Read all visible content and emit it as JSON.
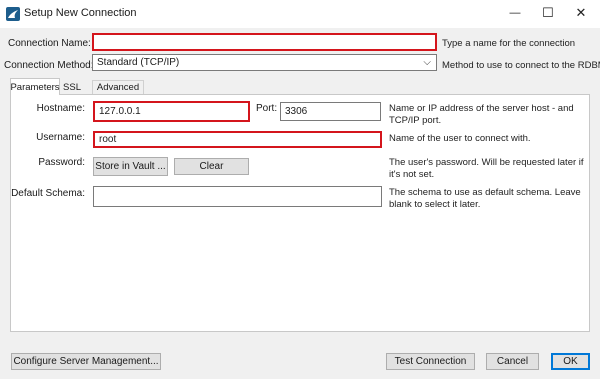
{
  "window": {
    "title": "Setup New Connection",
    "icon": "mysql-workbench-icon",
    "controls": {
      "minimize": "—",
      "maximize": "☐",
      "close": "✕"
    }
  },
  "connection_name": {
    "label": "Connection Name:",
    "value": "",
    "hint": "Type a name for the connection"
  },
  "connection_method": {
    "label": "Connection Method:",
    "value": "Standard (TCP/IP)",
    "hint": "Method to use to connect to the RDBMS"
  },
  "tabs": [
    {
      "label": "Parameters",
      "active": true
    },
    {
      "label": "SSL",
      "active": false
    },
    {
      "label": "Advanced",
      "active": false
    }
  ],
  "params": {
    "hostname": {
      "label": "Hostname:",
      "value": "127.0.0.1"
    },
    "port": {
      "label": "Port:",
      "value": "3306"
    },
    "host_hint": "Name or IP address of the server host - and TCP/IP port.",
    "username": {
      "label": "Username:",
      "value": "root",
      "hint": "Name of the user to connect with."
    },
    "password": {
      "label": "Password:",
      "store_button": "Store in Vault ...",
      "clear_button": "Clear",
      "hint": "The user's password. Will be requested later if it's not set."
    },
    "schema": {
      "label": "Default Schema:",
      "value": "",
      "hint": "The schema to use as default schema. Leave blank to select it later."
    }
  },
  "footer": {
    "configure_button": "Configure Server Management...",
    "test_button": "Test Connection",
    "cancel_button": "Cancel",
    "ok_button": "OK"
  },
  "colors": {
    "highlight": "#d4151c",
    "accent": "#0078d7",
    "dialog_bg": "#f0f0f0"
  }
}
